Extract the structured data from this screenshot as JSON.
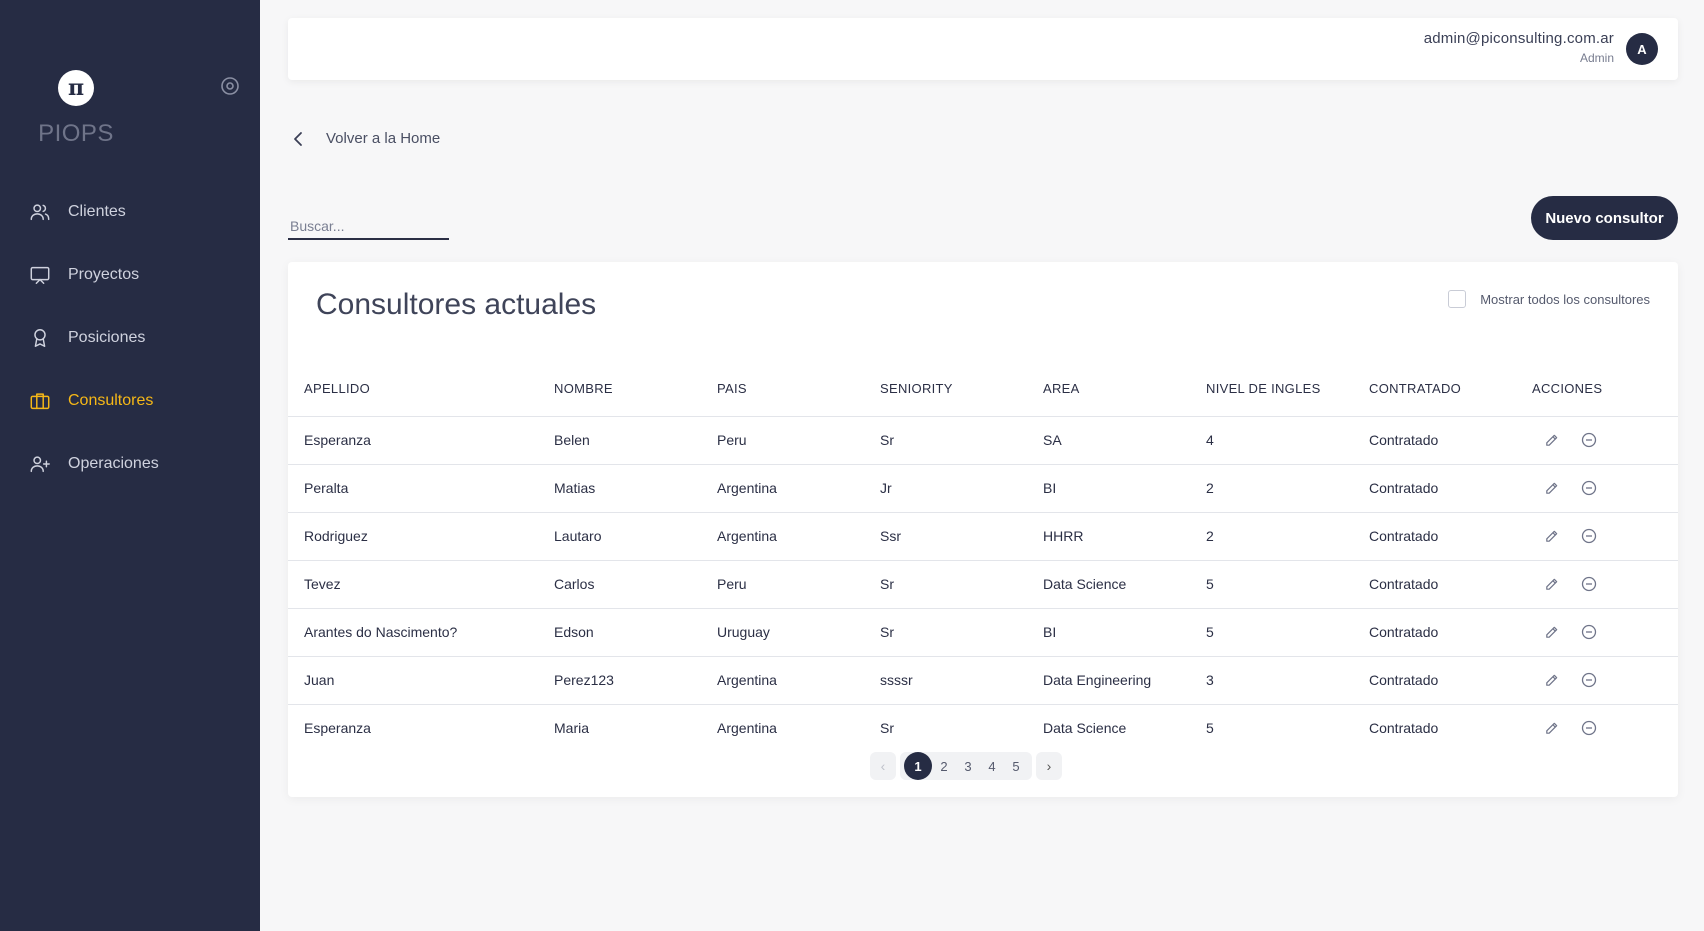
{
  "app": {
    "name": "PIOPS",
    "logo_glyph": "π"
  },
  "sidebar": {
    "items": [
      {
        "label": "Clientes",
        "icon": "users-icon",
        "active": false
      },
      {
        "label": "Proyectos",
        "icon": "presentation-icon",
        "active": false
      },
      {
        "label": "Posiciones",
        "icon": "award-icon",
        "active": false
      },
      {
        "label": "Consultores",
        "icon": "briefcase-icon",
        "active": true
      },
      {
        "label": "Operaciones",
        "icon": "user-plus-icon",
        "active": false
      }
    ],
    "accent_color": "#f6b817"
  },
  "header": {
    "email": "admin@piconsulting.com.ar",
    "role": "Admin",
    "avatar_initial": "A"
  },
  "back_link": {
    "label": "Volver a la Home"
  },
  "search": {
    "placeholder": "Buscar..."
  },
  "new_button": {
    "label": "Nuevo consultor"
  },
  "card": {
    "title": "Consultores actuales",
    "show_all_label": "Mostrar todos los consultores",
    "show_all_checked": false
  },
  "table": {
    "headers": [
      "APELLIDO",
      "NOMBRE",
      "PAIS",
      "SENIORITY",
      "AREA",
      "NIVEL DE INGLES",
      "CONTRATADO",
      "ACCIONES"
    ],
    "rows": [
      [
        "Esperanza",
        "Belen",
        "Peru",
        "Sr",
        "SA",
        "4",
        "Contratado"
      ],
      [
        "Peralta",
        "Matias",
        "Argentina",
        "Jr",
        "BI",
        "2",
        "Contratado"
      ],
      [
        "Rodriguez",
        "Lautaro",
        "Argentina",
        "Ssr",
        "HHRR",
        "2",
        "Contratado"
      ],
      [
        "Tevez",
        "Carlos",
        "Peru",
        "Sr",
        "Data Science",
        "5",
        "Contratado"
      ],
      [
        "Arantes do Nascimento?",
        "Edson",
        "Uruguay",
        "Sr",
        "BI",
        "5",
        "Contratado"
      ],
      [
        "Juan",
        "Perez123",
        "Argentina",
        "ssssr",
        "Data Engineering",
        "3",
        "Contratado"
      ],
      [
        "Esperanza",
        "Maria",
        "Argentina",
        "Sr",
        "Data Science",
        "5",
        "Contratado"
      ]
    ]
  },
  "pagination": {
    "prev": "‹",
    "next": "›",
    "pages": [
      "1",
      "2",
      "3",
      "4",
      "5"
    ],
    "current": "1"
  },
  "colors": {
    "primary": "#262c44",
    "accent": "#f6b817"
  }
}
